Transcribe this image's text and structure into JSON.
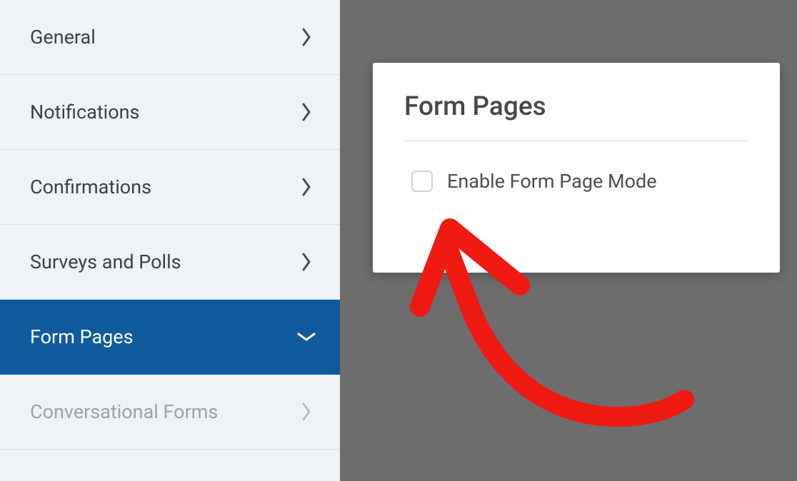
{
  "sidebar": {
    "items": [
      {
        "label": "General",
        "state": "collapsed"
      },
      {
        "label": "Notifications",
        "state": "collapsed"
      },
      {
        "label": "Confirmations",
        "state": "collapsed"
      },
      {
        "label": "Surveys and Polls",
        "state": "collapsed"
      },
      {
        "label": "Form Pages",
        "state": "expanded"
      },
      {
        "label": "Conversational Forms",
        "state": "collapsed"
      }
    ]
  },
  "panel": {
    "title": "Form Pages",
    "checkbox_label": "Enable Form Page Mode",
    "checkbox_checked": false
  },
  "annotation": {
    "color": "#ef1a12"
  }
}
